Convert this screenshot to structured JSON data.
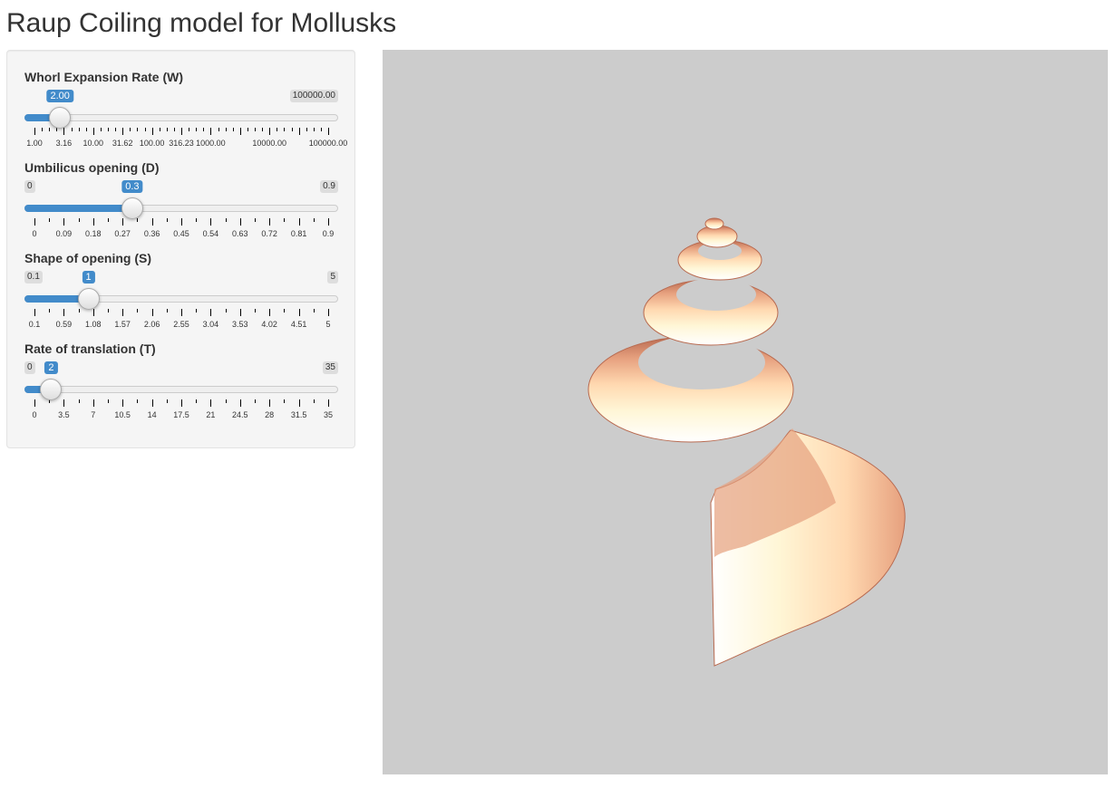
{
  "page_title": "Raup Coiling model for Mollusks",
  "sliders": [
    {
      "id": "w",
      "label": "Whorl Expansion Rate (W)",
      "min_label": "",
      "max_label": "100000.00",
      "value_label": "2.00",
      "value_fraction": 0.087,
      "ticks": [
        "1.00",
        "3.16",
        "10.00",
        "31.62",
        "100.00",
        "316.23",
        "1000.00",
        "",
        "10000.00",
        "",
        "100000.00"
      ],
      "major_every": 2,
      "minor_per_major": 4
    },
    {
      "id": "d",
      "label": "Umbilicus opening (D)",
      "min_label": "0",
      "max_label": "0.9",
      "value_label": "0.3",
      "value_fraction": 0.333,
      "ticks": [
        "0",
        "0.09",
        "0.18",
        "0.27",
        "0.36",
        "0.45",
        "0.54",
        "0.63",
        "0.72",
        "0.81",
        "0.9"
      ],
      "major_every": 1,
      "minor_per_major": 2
    },
    {
      "id": "s",
      "label": "Shape of opening (S)",
      "min_label": "0.1",
      "max_label": "5",
      "value_label": "1",
      "value_fraction": 0.184,
      "ticks": [
        "0.1",
        "0.59",
        "1.08",
        "1.57",
        "2.06",
        "2.55",
        "3.04",
        "3.53",
        "4.02",
        "4.51",
        "5"
      ],
      "major_every": 1,
      "minor_per_major": 2
    },
    {
      "id": "t",
      "label": "Rate of translation (T)",
      "min_label": "0",
      "max_label": "35",
      "value_label": "2",
      "value_fraction": 0.057,
      "ticks": [
        "0",
        "3.5",
        "7",
        "10.5",
        "14",
        "17.5",
        "21",
        "24.5",
        "28",
        "31.5",
        "35"
      ],
      "major_every": 1,
      "minor_per_major": 2
    }
  ],
  "viewer": {
    "background": "#cccccc",
    "shell_colors": [
      "#b86a50",
      "#e6a07e",
      "#ffd8b0",
      "#fff6d6",
      "#ffffff"
    ]
  }
}
